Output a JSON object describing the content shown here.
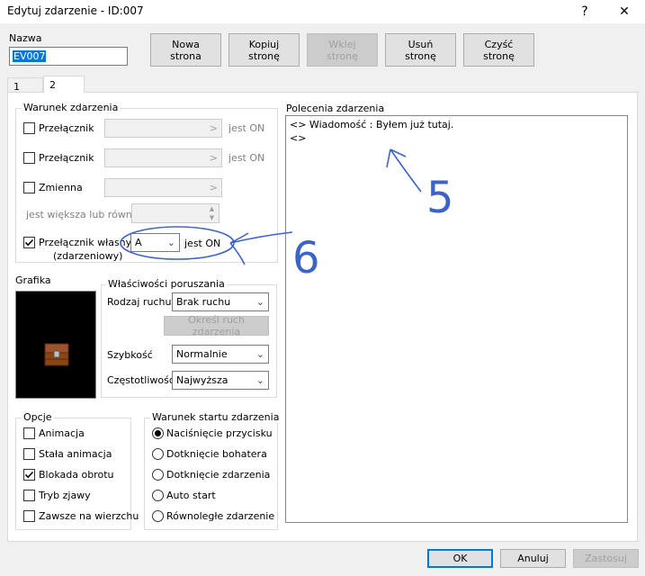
{
  "window": {
    "title": "Edytuj zdarzenie - ID:007",
    "help": "?",
    "close": "✕"
  },
  "name_section": {
    "label": "Nazwa",
    "value": "EV007"
  },
  "toolbar": {
    "new_page": [
      "Nowa",
      "strona"
    ],
    "copy_page": [
      "Kopiuj",
      "stronę"
    ],
    "paste_page": [
      "Wklej",
      "stronę"
    ],
    "delete_page": [
      "Usuń",
      "stronę"
    ],
    "clear_page": [
      "Czyść",
      "stronę"
    ]
  },
  "tabs": [
    {
      "label": "1"
    },
    {
      "label": "2"
    }
  ],
  "conditions": {
    "title": "Warunek zdarzenia",
    "switch1": {
      "label": "Przełącznik",
      "suffix": "jest ON",
      "checked": false
    },
    "switch2": {
      "label": "Przełącznik",
      "suffix": "jest ON",
      "checked": false
    },
    "variable": {
      "label": "Zmienna",
      "checked": false
    },
    "compare_label": "jest większa lub równa",
    "self_switch": {
      "label1": "Przełącznik własny",
      "label2": "(zdarzeniowy)",
      "value": "A",
      "suffix": "jest ON",
      "checked": true
    }
  },
  "graphic": {
    "label": "Grafika"
  },
  "movement": {
    "title": "Właściwości poruszania",
    "type_label": "Rodzaj ruchu",
    "type_value": "Brak ruchu",
    "route_button": "Określ ruch zdarzenia",
    "speed_label": "Szybkość",
    "speed_value": "Normalnie",
    "freq_label": "Częstotliwość",
    "freq_value": "Najwyższa"
  },
  "options": {
    "title": "Opcje",
    "items": [
      {
        "label": "Animacja",
        "checked": false
      },
      {
        "label": "Stała animacja",
        "checked": false
      },
      {
        "label": "Blokada obrotu",
        "checked": true
      },
      {
        "label": "Tryb zjawy",
        "checked": false
      },
      {
        "label": "Zawsze na wierzchu",
        "checked": false
      }
    ]
  },
  "trigger": {
    "title": "Warunek startu zdarzenia",
    "items": [
      {
        "label": "Naciśnięcie przycisku",
        "selected": true
      },
      {
        "label": "Dotknięcie bohatera",
        "selected": false
      },
      {
        "label": "Dotknięcie zdarzenia",
        "selected": false
      },
      {
        "label": "Auto start",
        "selected": false
      },
      {
        "label": "Równoległe zdarzenie",
        "selected": false
      }
    ]
  },
  "commands": {
    "title": "Polecenia zdarzenia",
    "lines": [
      "<> Wiadomość : Byłem już tutaj.",
      "<>"
    ]
  },
  "annotations": {
    "five": "5",
    "six": "6"
  },
  "footer": {
    "ok": "OK",
    "cancel": "Anuluj",
    "apply": "Zastosuj"
  },
  "colors": {
    "accent": "#0078d7",
    "annotation": "#3c64c8"
  }
}
